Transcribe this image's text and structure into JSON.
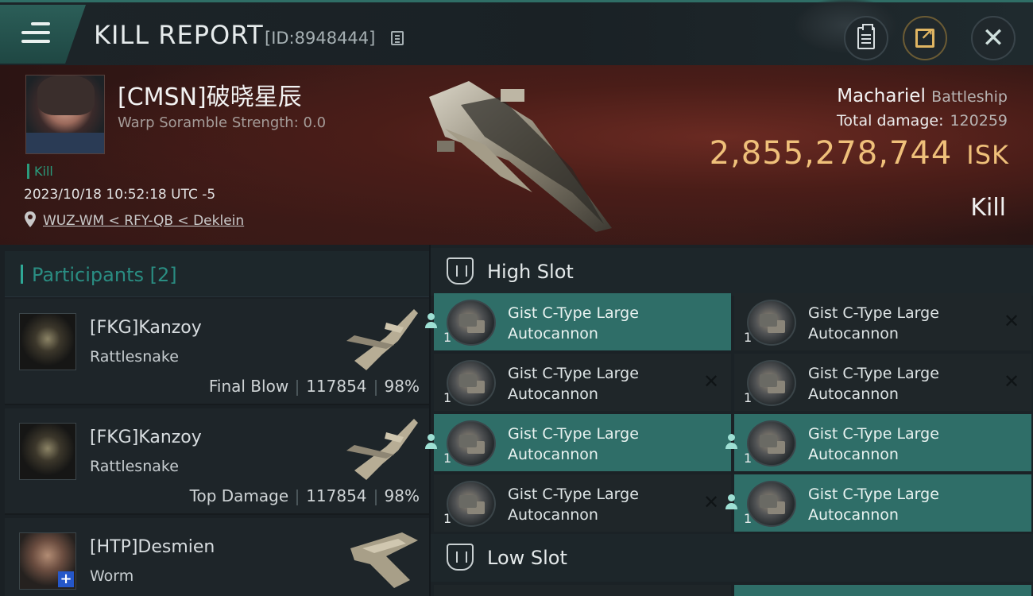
{
  "header": {
    "title": "KILL REPORT",
    "report_id": "[ID:8948444]"
  },
  "victim": {
    "name": "[CMSN]破晓星辰",
    "warp_scramble": "Warp Soramble Strength: 0.0",
    "tag": "Kill",
    "timestamp": "2023/10/18 10:52:18 UTC -5",
    "location": "WUZ-WM < RFY-QB < Deklein",
    "ship_name": "Machariel",
    "ship_class": "Battleship",
    "total_damage_label": "Total damage:",
    "total_damage": "120259",
    "isk_value": "2,855,278,744",
    "isk_unit": "ISK",
    "status": "Kill"
  },
  "participants": {
    "title": "Participants [2]",
    "items": [
      {
        "name": "[FKG]Kanzoy",
        "ship": "Rattlesnake",
        "role": "Final Blow",
        "damage": "117854",
        "percent": "98%"
      },
      {
        "name": "[FKG]Kanzoy",
        "ship": "Rattlesnake",
        "role": "Top Damage",
        "damage": "117854",
        "percent": "98%"
      },
      {
        "name": "[HTP]Desmien",
        "ship": "Worm"
      }
    ]
  },
  "slots": {
    "high_label": "High Slot",
    "low_label": "Low Slot",
    "high_modules": [
      {
        "line1": "Gist C-Type Large",
        "line2": "Autocannon",
        "qty": "1",
        "state": "dropped"
      },
      {
        "line1": "Gist C-Type Large",
        "line2": "Autocannon",
        "qty": "1",
        "state": "destroyed"
      },
      {
        "line1": "Gist C-Type Large",
        "line2": "Autocannon",
        "qty": "1",
        "state": "destroyed"
      },
      {
        "line1": "Gist C-Type Large",
        "line2": "Autocannon",
        "qty": "1",
        "state": "destroyed"
      },
      {
        "line1": "Gist C-Type Large",
        "line2": "Autocannon",
        "qty": "1",
        "state": "dropped"
      },
      {
        "line1": "Gist C-Type Large",
        "line2": "Autocannon",
        "qty": "1",
        "state": "dropped"
      },
      {
        "line1": "Gist C-Type Large",
        "line2": "Autocannon",
        "qty": "1",
        "state": "destroyed"
      },
      {
        "line1": "Gist C-Type Large",
        "line2": "Autocannon",
        "qty": "1",
        "state": "dropped"
      }
    ]
  },
  "colors": {
    "accent_teal": "#2f6e68",
    "isk_gold": "#efc07a",
    "banner_red": "#4a1d18"
  },
  "icons": [
    "menu-icon",
    "copy-icon",
    "clipboard-icon",
    "share-icon",
    "close-icon",
    "location-pin-icon",
    "high-slot-icon",
    "low-slot-icon",
    "person-icon",
    "x-icon"
  ]
}
